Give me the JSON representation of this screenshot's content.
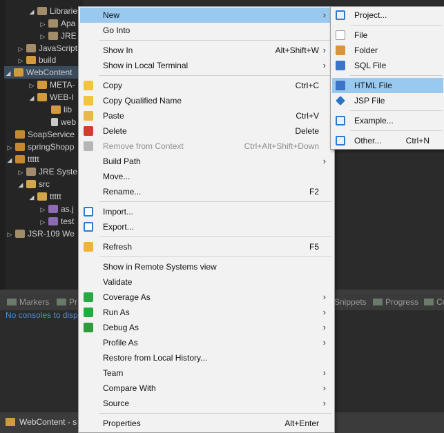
{
  "tree": {
    "items": [
      {
        "label": "Libraries",
        "arrow": "◢"
      },
      {
        "label": "Apa",
        "arrow": "▷"
      },
      {
        "label": "JRE",
        "arrow": "▷"
      },
      {
        "label": "JavaScript",
        "arrow": "▷"
      },
      {
        "label": "build",
        "arrow": "▷"
      },
      {
        "label": "WebContent",
        "arrow": "◢"
      },
      {
        "label": "META-",
        "arrow": "▷"
      },
      {
        "label": "WEB-I",
        "arrow": "◢"
      },
      {
        "label": "lib",
        "arrow": ""
      },
      {
        "label": "web",
        "arrow": ""
      },
      {
        "label": "SoapService",
        "arrow": ""
      },
      {
        "label": "springShopp",
        "arrow": "▷"
      },
      {
        "label": "ttttt",
        "arrow": "◢"
      },
      {
        "label": "JRE Syste",
        "arrow": "▷"
      },
      {
        "label": "src",
        "arrow": "◢"
      },
      {
        "label": "ttttt",
        "arrow": "◢"
      },
      {
        "label": "as.j",
        "arrow": "▷"
      },
      {
        "label": "test",
        "arrow": "▷"
      },
      {
        "label": "JSR-109 We",
        "arrow": "▷"
      }
    ]
  },
  "bottom": {
    "tabs": {
      "markers": "Markers",
      "pr": "Pr",
      "snippets": "Snippets",
      "progress": "Progress",
      "co": "Co"
    },
    "console_message": "No consoles to disp",
    "status": "WebContent - s"
  },
  "context_menu": {
    "new": "New",
    "go_into": "Go Into",
    "show_in": "Show In",
    "show_in_shortcut": "Alt+Shift+W",
    "show_in_local_terminal": "Show in Local Terminal",
    "copy": "Copy",
    "copy_shortcut": "Ctrl+C",
    "copy_qualified_name": "Copy Qualified Name",
    "paste": "Paste",
    "paste_shortcut": "Ctrl+V",
    "delete": "Delete",
    "delete_shortcut": "Delete",
    "remove_from_context": "Remove from Context",
    "remove_shortcut": "Ctrl+Alt+Shift+Down",
    "build_path": "Build Path",
    "move": "Move...",
    "rename": "Rename...",
    "rename_shortcut": "F2",
    "import": "Import...",
    "export": "Export...",
    "refresh": "Refresh",
    "refresh_shortcut": "F5",
    "show_in_remote": "Show in Remote Systems view",
    "validate": "Validate",
    "coverage_as": "Coverage As",
    "run_as": "Run As",
    "debug_as": "Debug As",
    "profile_as": "Profile As",
    "restore_history": "Restore from Local History...",
    "team": "Team",
    "compare_with": "Compare With",
    "source": "Source",
    "properties": "Properties",
    "properties_shortcut": "Alt+Enter",
    "submenu_arrow": "›"
  },
  "new_submenu": {
    "project": "Project...",
    "file": "File",
    "folder": "Folder",
    "sql_file": "SQL File",
    "html_file": "HTML File",
    "jsp_file": "JSP File",
    "example": "Example...",
    "other": "Other...",
    "other_shortcut": "Ctrl+N"
  },
  "colors": {
    "highlight": "#99c9ef",
    "menu_bg": "#f2f2f2",
    "ide_dark": "#2b2b2b",
    "console_link": "#4f8ed6"
  }
}
